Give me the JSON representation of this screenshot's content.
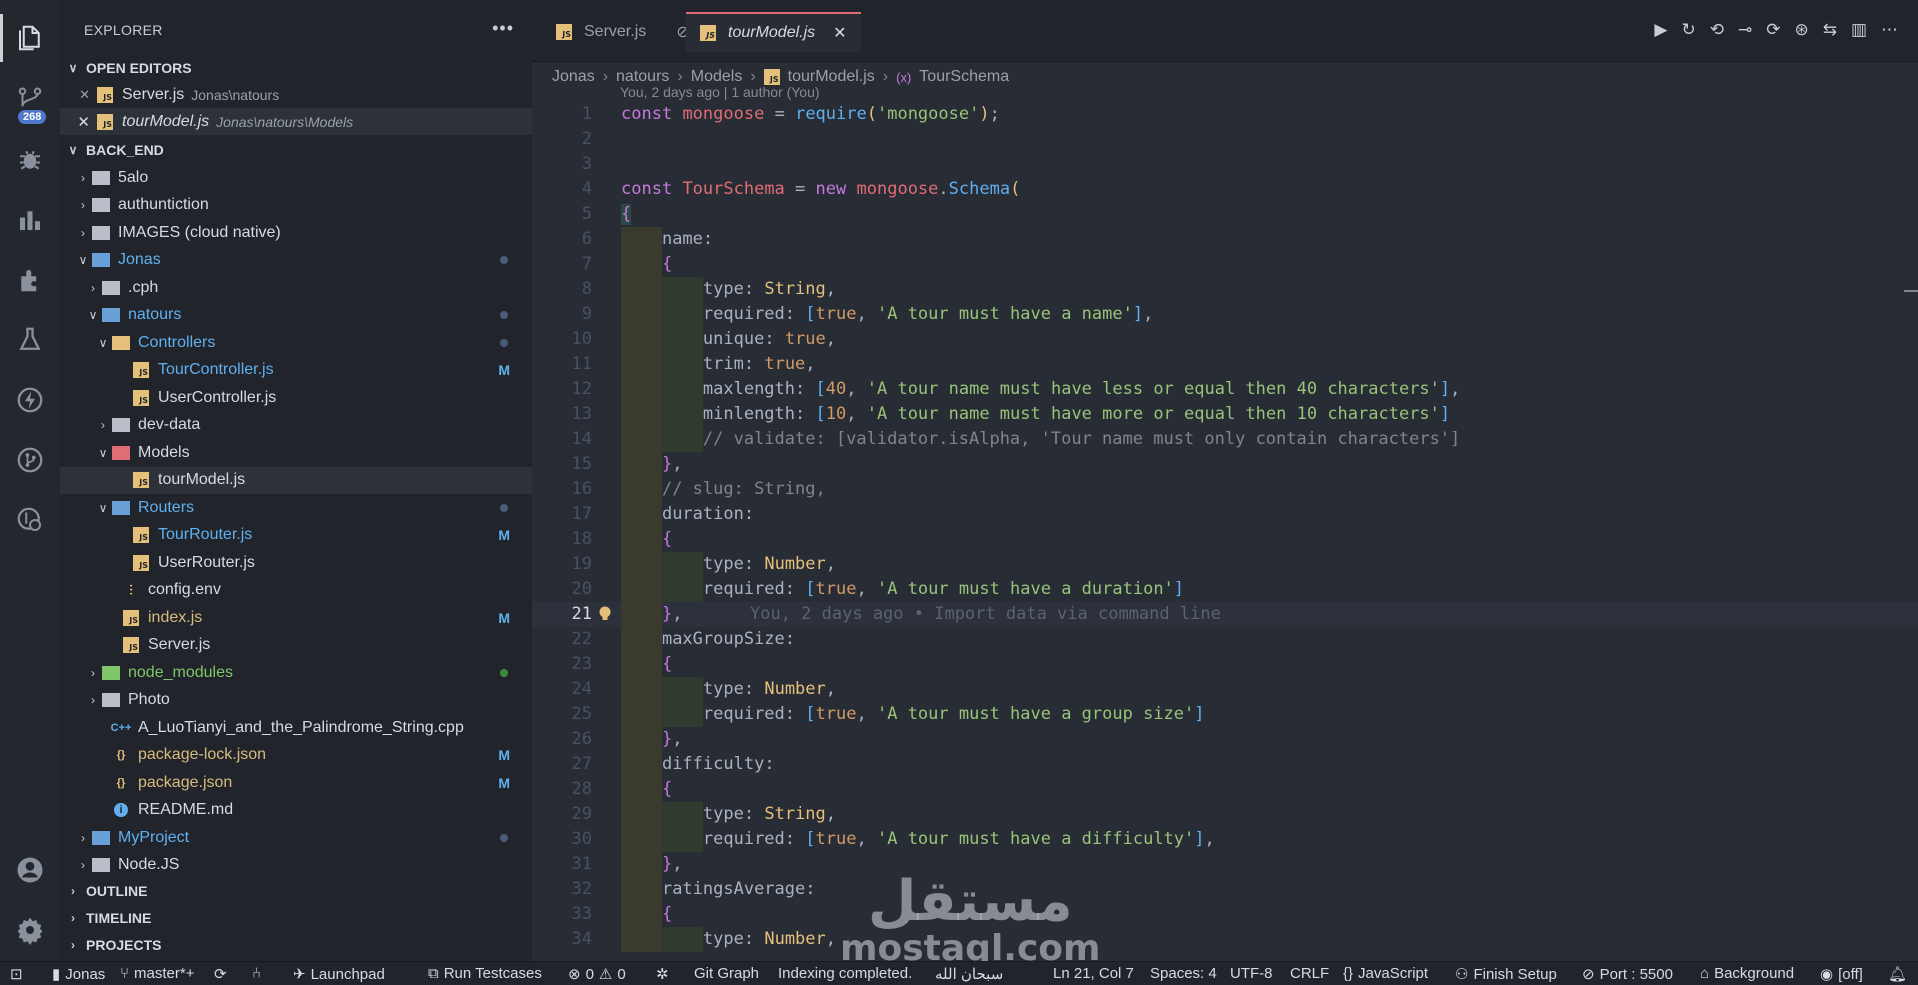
{
  "sidebar": {
    "title": "EXPLORER",
    "more_label": "•••",
    "open_editors_label": "OPEN EDITORS",
    "open_editors": [
      {
        "name": "Server.js",
        "desc": "Jonas\\natours"
      },
      {
        "name": "tourModel.js",
        "desc": "Jonas\\natours\\Models"
      }
    ],
    "root_label": "BACK_END",
    "tree": [
      {
        "name": "5alo"
      },
      {
        "name": "authuntiction"
      },
      {
        "name": "IMAGES (cloud native)"
      },
      {
        "name": "Jonas"
      },
      {
        "name": ".cph"
      },
      {
        "name": "natours"
      },
      {
        "name": "Controllers"
      },
      {
        "name": "TourController.js",
        "deco": "M"
      },
      {
        "name": "UserController.js"
      },
      {
        "name": "dev-data"
      },
      {
        "name": "Models"
      },
      {
        "name": "tourModel.js"
      },
      {
        "name": "Routers"
      },
      {
        "name": "TourRouter.js",
        "deco": "M"
      },
      {
        "name": "UserRouter.js"
      },
      {
        "name": "config.env"
      },
      {
        "name": "index.js",
        "deco": "M"
      },
      {
        "name": "Server.js"
      },
      {
        "name": "node_modules"
      },
      {
        "name": "Photo"
      },
      {
        "name": "A_LuoTianyi_and_the_Palindrome_String.cpp"
      },
      {
        "name": "package-lock.json",
        "deco": "M"
      },
      {
        "name": "package.json",
        "deco": "M"
      },
      {
        "name": "README.md"
      },
      {
        "name": "MyProject"
      },
      {
        "name": "Node.JS"
      }
    ],
    "outline_label": "OUTLINE",
    "timeline_label": "TIMELINE",
    "projects_label": "PROJECTS"
  },
  "activity": {
    "scm_badge": "268"
  },
  "tabs": [
    {
      "label": "Server.js",
      "state": "inactive"
    },
    {
      "label": "tourModel.js",
      "state": "active"
    }
  ],
  "breadcrumb": [
    "Jonas",
    "natours",
    "Models",
    "tourModel.js",
    "TourSchema"
  ],
  "blame_header": "You, 2 days ago | 1 author (You)",
  "inline_blame": "You, 2 days ago • Import data via command line",
  "code_lines": [
    "const mongoose = require('mongoose');",
    "",
    "",
    "const TourSchema = new mongoose.Schema(",
    "{",
    "    name:",
    "    {",
    "        type: String,",
    "        required: [true, 'A tour must have a name'],",
    "        unique: true,",
    "        trim: true,",
    "        maxlength: [40, 'A tour name must have less or equal then 40 characters'],",
    "        minlength: [10, 'A tour name must have more or equal then 10 characters']",
    "        // validate: [validator.isAlpha, 'Tour name must only contain characters']",
    "    },",
    "    // slug: String,",
    "    duration:",
    "    {",
    "        type: Number,",
    "        required: [true, 'A tour must have a duration']",
    "    },",
    "    maxGroupSize:",
    "    {",
    "        type: Number,",
    "        required: [true, 'A tour must have a group size']",
    "    },",
    "    difficulty:",
    "    {",
    "        type: String,",
    "        required: [true, 'A tour must have a difficulty'],",
    "    },",
    "    ratingsAverage:",
    "    {",
    "        type: Number,"
  ],
  "current_line": 21,
  "status": {
    "workspace": "Jonas",
    "branch": "master*+",
    "launchpad": "Launchpad",
    "run_testcases": "Run Testcases",
    "errors": "0",
    "warnings": "0",
    "git_graph": "Git Graph",
    "indexing": "Indexing completed.",
    "arabic": "سبحان الله",
    "position": "Ln 21, Col 7",
    "spaces": "Spaces: 4",
    "encoding": "UTF-8",
    "eol": "CRLF",
    "language": "JavaScript",
    "finish_setup": "Finish Setup",
    "port": "Port : 5500",
    "background": "Background",
    "off": "[off]"
  },
  "watermark": {
    "arabic": "مستقل",
    "latin": "mostaql.com"
  },
  "colors": {
    "accent_tab": "#e06c75",
    "badge": "#4d78cc",
    "modified": "#d7ba7d",
    "folder_blue": "#61afef"
  }
}
